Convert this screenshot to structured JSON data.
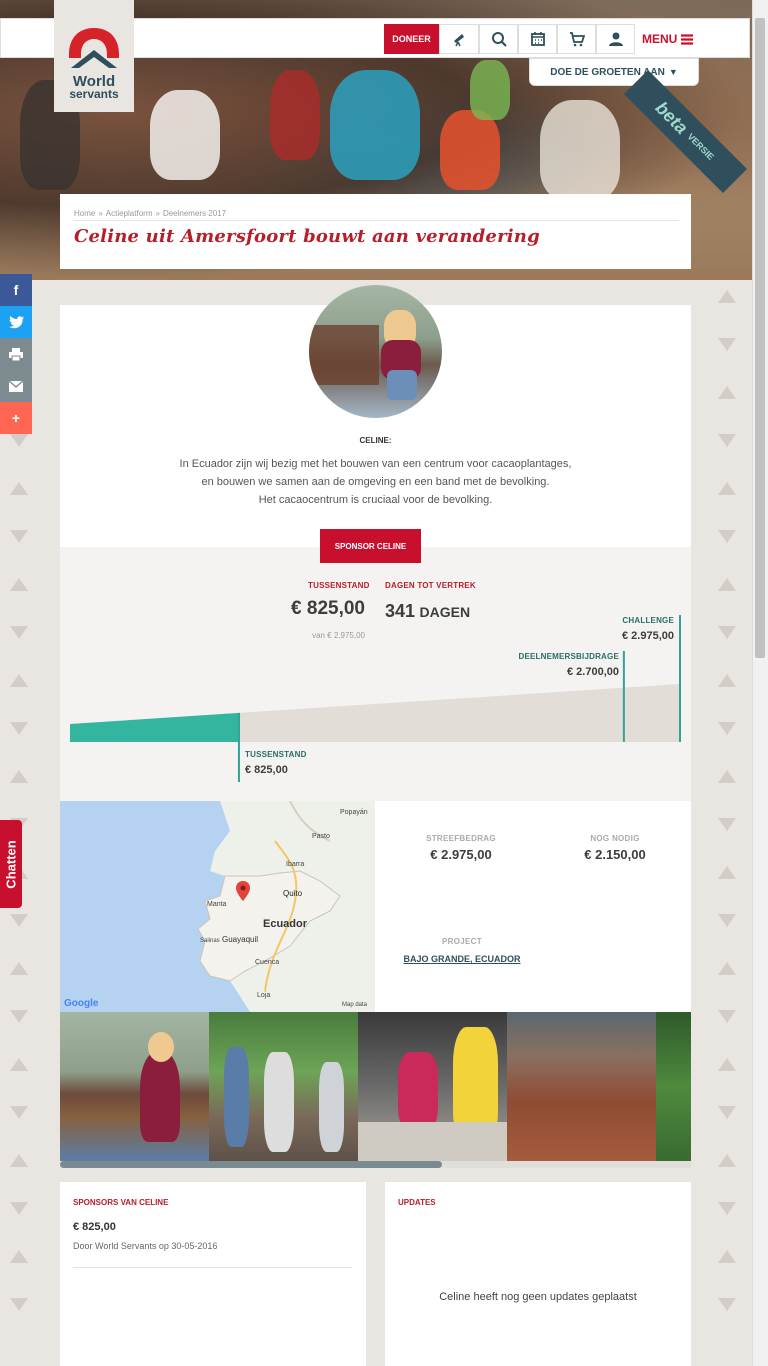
{
  "brand": {
    "logo_line1": "World",
    "logo_line2": "servants",
    "primary": "#c8102e",
    "dark": "#2f4f5c",
    "teal": "#33b5a0"
  },
  "nav": {
    "donate_label": "DONEER",
    "menu_label": "MENU",
    "greet_label": "DOE DE GROETEN AAN",
    "beta_label": "beta",
    "beta_sub": "VERSIE"
  },
  "breadcrumb": {
    "home": "Home",
    "sep": "»",
    "platform": "Actieplatform",
    "participants": "Deelnemers 2017"
  },
  "page": {
    "title": "Celine uit Amersfoort bouwt aan verandering"
  },
  "share": [
    "f",
    "t",
    "p",
    "m",
    "+"
  ],
  "chat_label": "Chatten",
  "intro": {
    "name": "CELINE:",
    "line1": "In Ecuador zijn wij bezig met het bouwen van een centrum voor cacaoplantages,",
    "line2": "en bouwen we samen aan de omgeving en een band met de bevolking.",
    "line3": "Het cacaocentrum is cruciaal voor de bevolking."
  },
  "sponsor_button": "SPONSOR CELINE",
  "progress": {
    "tussenstand_label": "TUSSENSTAND",
    "tussenstand_value": "€ 825,00",
    "van_label": "van € 2.975,00",
    "dagen_label": "DAGEN TOT VERTREK",
    "dagen_value": "341",
    "dagen_unit": "DAGEN",
    "challenge_label": "CHALLENGE",
    "challenge_value": "€ 2.975,00",
    "budget_label": "DEELNEMERSBIJDRAGE",
    "budget_value": "€ 2.700,00",
    "bottom_label": "TUSSENSTAND",
    "bottom_value": "€ 825,00",
    "raised_fraction": 0.277,
    "budget_fraction": 0.908
  },
  "map": {
    "country": "Ecuador",
    "cities": [
      "Popayán",
      "Pasto",
      "Ibarra",
      "Quito",
      "Manta",
      "Salinas",
      "Guayaquil",
      "Cuenca",
      "Loja"
    ],
    "attribution": "Map data",
    "google": "Google"
  },
  "stats": {
    "goal_label": "STREEFBEDRAG",
    "goal_value": "€ 2.975,00",
    "needed_label": "NOG NODIG",
    "needed_value": "€ 2.150,00",
    "project_label": "PROJECT",
    "project_value": "BAJO GRANDE, ECUADOR"
  },
  "sponsors": {
    "title": "SPONSORS VAN CELINE",
    "amount": "€ 825,00",
    "by": "Door World Servants op 30-05-2016"
  },
  "updates": {
    "title": "UPDATES",
    "empty": "Celine heeft nog geen updates geplaatst"
  }
}
